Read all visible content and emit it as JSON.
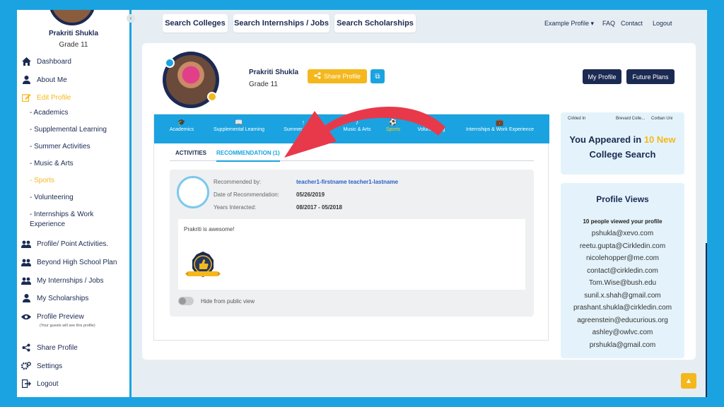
{
  "sidebar": {
    "name": "Prakriti Shukla",
    "grade": "Grade 11",
    "collapse_icon": "‹",
    "items": [
      {
        "label": "Dashboard",
        "icon": "home-icon"
      },
      {
        "label": "About Me",
        "icon": "user-icon"
      },
      {
        "label": "Edit Profile",
        "icon": "edit-icon"
      },
      {
        "label": "Profile/ Point Activities.",
        "icon": "users-icon"
      },
      {
        "label": "Beyond High School Plan",
        "icon": "users-icon"
      },
      {
        "label": "My Internships / Jobs",
        "icon": "users-icon"
      },
      {
        "label": "My Scholarships",
        "icon": "user-icon"
      },
      {
        "label": "Profile Preview",
        "icon": "eye-icon"
      },
      {
        "label": "Share Profile",
        "icon": "share-icon"
      },
      {
        "label": "Settings",
        "icon": "gear-icon"
      },
      {
        "label": "Logout",
        "icon": "logout-icon"
      }
    ],
    "sub_items": [
      "- Academics",
      "- Supplemental Learning",
      "- Summer Activities",
      "- Music & Arts",
      "- Sports",
      "- Volunteering",
      "- Internships & Work Experience"
    ],
    "preview_note": "(Your guests will see this profile)"
  },
  "topbar": {
    "search_colleges": "Search Colleges",
    "search_internships": "Search Internships / Jobs",
    "search_scholarships": "Search Scholarships",
    "example_profile": "Example Profile ▾",
    "faq": "FAQ",
    "contact": "Contact",
    "logout": "Logout"
  },
  "profile": {
    "name": "Prakriti Shukla",
    "grade": "Grade 11",
    "share_label": "Share Profile",
    "copy_icon": "⧉",
    "my_profile": "My Profile",
    "future_plans": "Future Plans"
  },
  "tabs": [
    {
      "label": "Academics",
      "icon": "🎓"
    },
    {
      "label": "Supplemental Learning",
      "icon": "📖"
    },
    {
      "label": "Summer Activities",
      "icon": "↑"
    },
    {
      "label": "Music & Arts",
      "icon": "♪"
    },
    {
      "label": "Sports",
      "icon": "⚽"
    },
    {
      "label": "Volunteering",
      "icon": "🤝"
    },
    {
      "label": "Internships & Work Experience",
      "icon": "💼"
    }
  ],
  "subtabs": {
    "activities": "ACTIVITIES",
    "recommendation": "RECOMMENDATION (1)"
  },
  "recommendation": {
    "recommended_by_label": "Recommended by:",
    "recommended_by": "teacher1-firstname teacher1-lastname",
    "date_label": "Date of Recommendation:",
    "date": "05/26/2019",
    "years_label": "Years Interacted:",
    "years": "08/2017 - 05/2018",
    "comment": "Prakriti is awesome!",
    "hide_label": "Hide from public view"
  },
  "colleges_strip": [
    "Cirkled In",
    "Brevard Colle...",
    "Corban Uni"
  ],
  "appeared": {
    "prefix": "You Appeared in",
    "highlight": "10 New",
    "suffix": "College Search"
  },
  "profile_views": {
    "title": "Profile Views",
    "count_text": "10 people viewed your profile",
    "emails": [
      "pshukla@xevo.com",
      "reetu.gupta@Cirkledin.com",
      "nicolehopper@me.com",
      "contact@cirkledin.com",
      "Tom.Wise@bush.edu",
      "sunil.x.shah@gmail.com",
      "prashant.shukla@cirkledin.com",
      "agreenstein@educurious.org",
      "ashley@owlvc.com",
      "prshukla@gmail.com"
    ]
  },
  "colors": {
    "accent": "#1aa3e0",
    "brand": "#1b2a52",
    "highlight": "#f4b81d",
    "arrow": "#e8394a"
  }
}
